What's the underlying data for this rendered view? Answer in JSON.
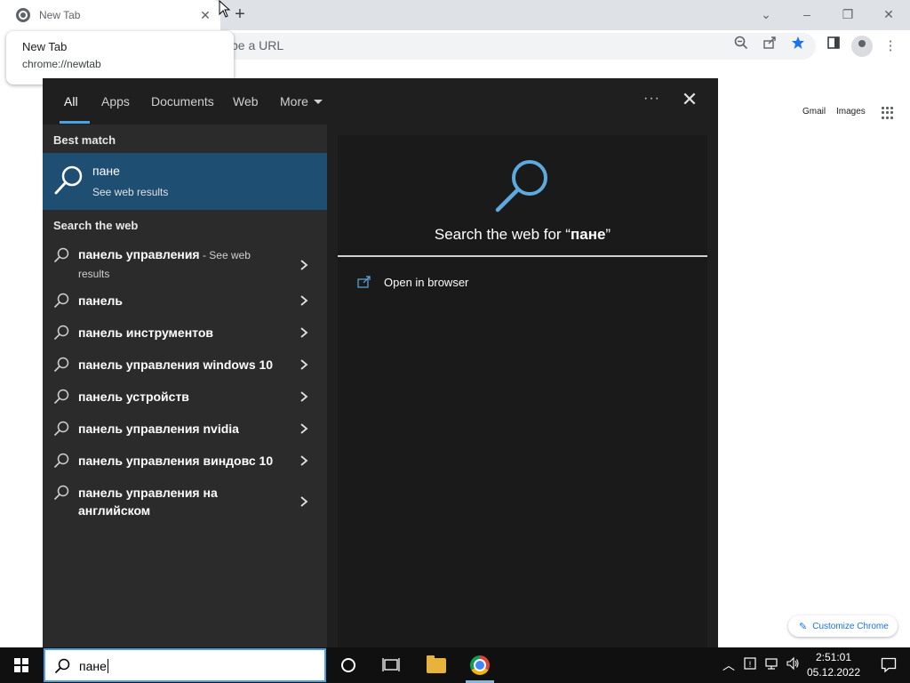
{
  "chrome": {
    "tab_title": "New Tab",
    "tooltip": {
      "title": "New Tab",
      "url": "chrome://newtab"
    },
    "omnibox_placeholder": "pe a URL",
    "ntp": {
      "gmail": "Gmail",
      "images": "Images",
      "customize": "Customize Chrome"
    }
  },
  "search_panel": {
    "filters": [
      "All",
      "Apps",
      "Documents",
      "Web",
      "More"
    ],
    "best_match_label": "Best match",
    "best_match": {
      "title": "пане",
      "subtitle": "See web results"
    },
    "search_web_label": "Search the web",
    "web_results": [
      {
        "text": "панель управления",
        "suffix": " - See web results"
      },
      {
        "text": "панель",
        "suffix": ""
      },
      {
        "text": "панель инструментов",
        "suffix": ""
      },
      {
        "text": "панель управления windows 10",
        "suffix": ""
      },
      {
        "text": "панель устройств",
        "suffix": ""
      },
      {
        "text": "панель управления nvidia",
        "suffix": ""
      },
      {
        "text": "панель управления виндовс 10",
        "suffix": ""
      },
      {
        "text": "панель управления на английском",
        "suffix": ""
      }
    ],
    "preview": {
      "heading_prefix": "Search the web for “",
      "heading_query": "пане",
      "heading_suffix": "”",
      "open_in_browser": "Open in browser"
    }
  },
  "taskbar": {
    "search_text": "пане",
    "clock_time": "2:51:01",
    "clock_date": "05.12.2022"
  },
  "colors": {
    "accent": "#4aa3e0",
    "best_match_bg": "#1f4e73",
    "panel_bg": "#1f1f1f",
    "taskbar_bg": "#101010"
  }
}
